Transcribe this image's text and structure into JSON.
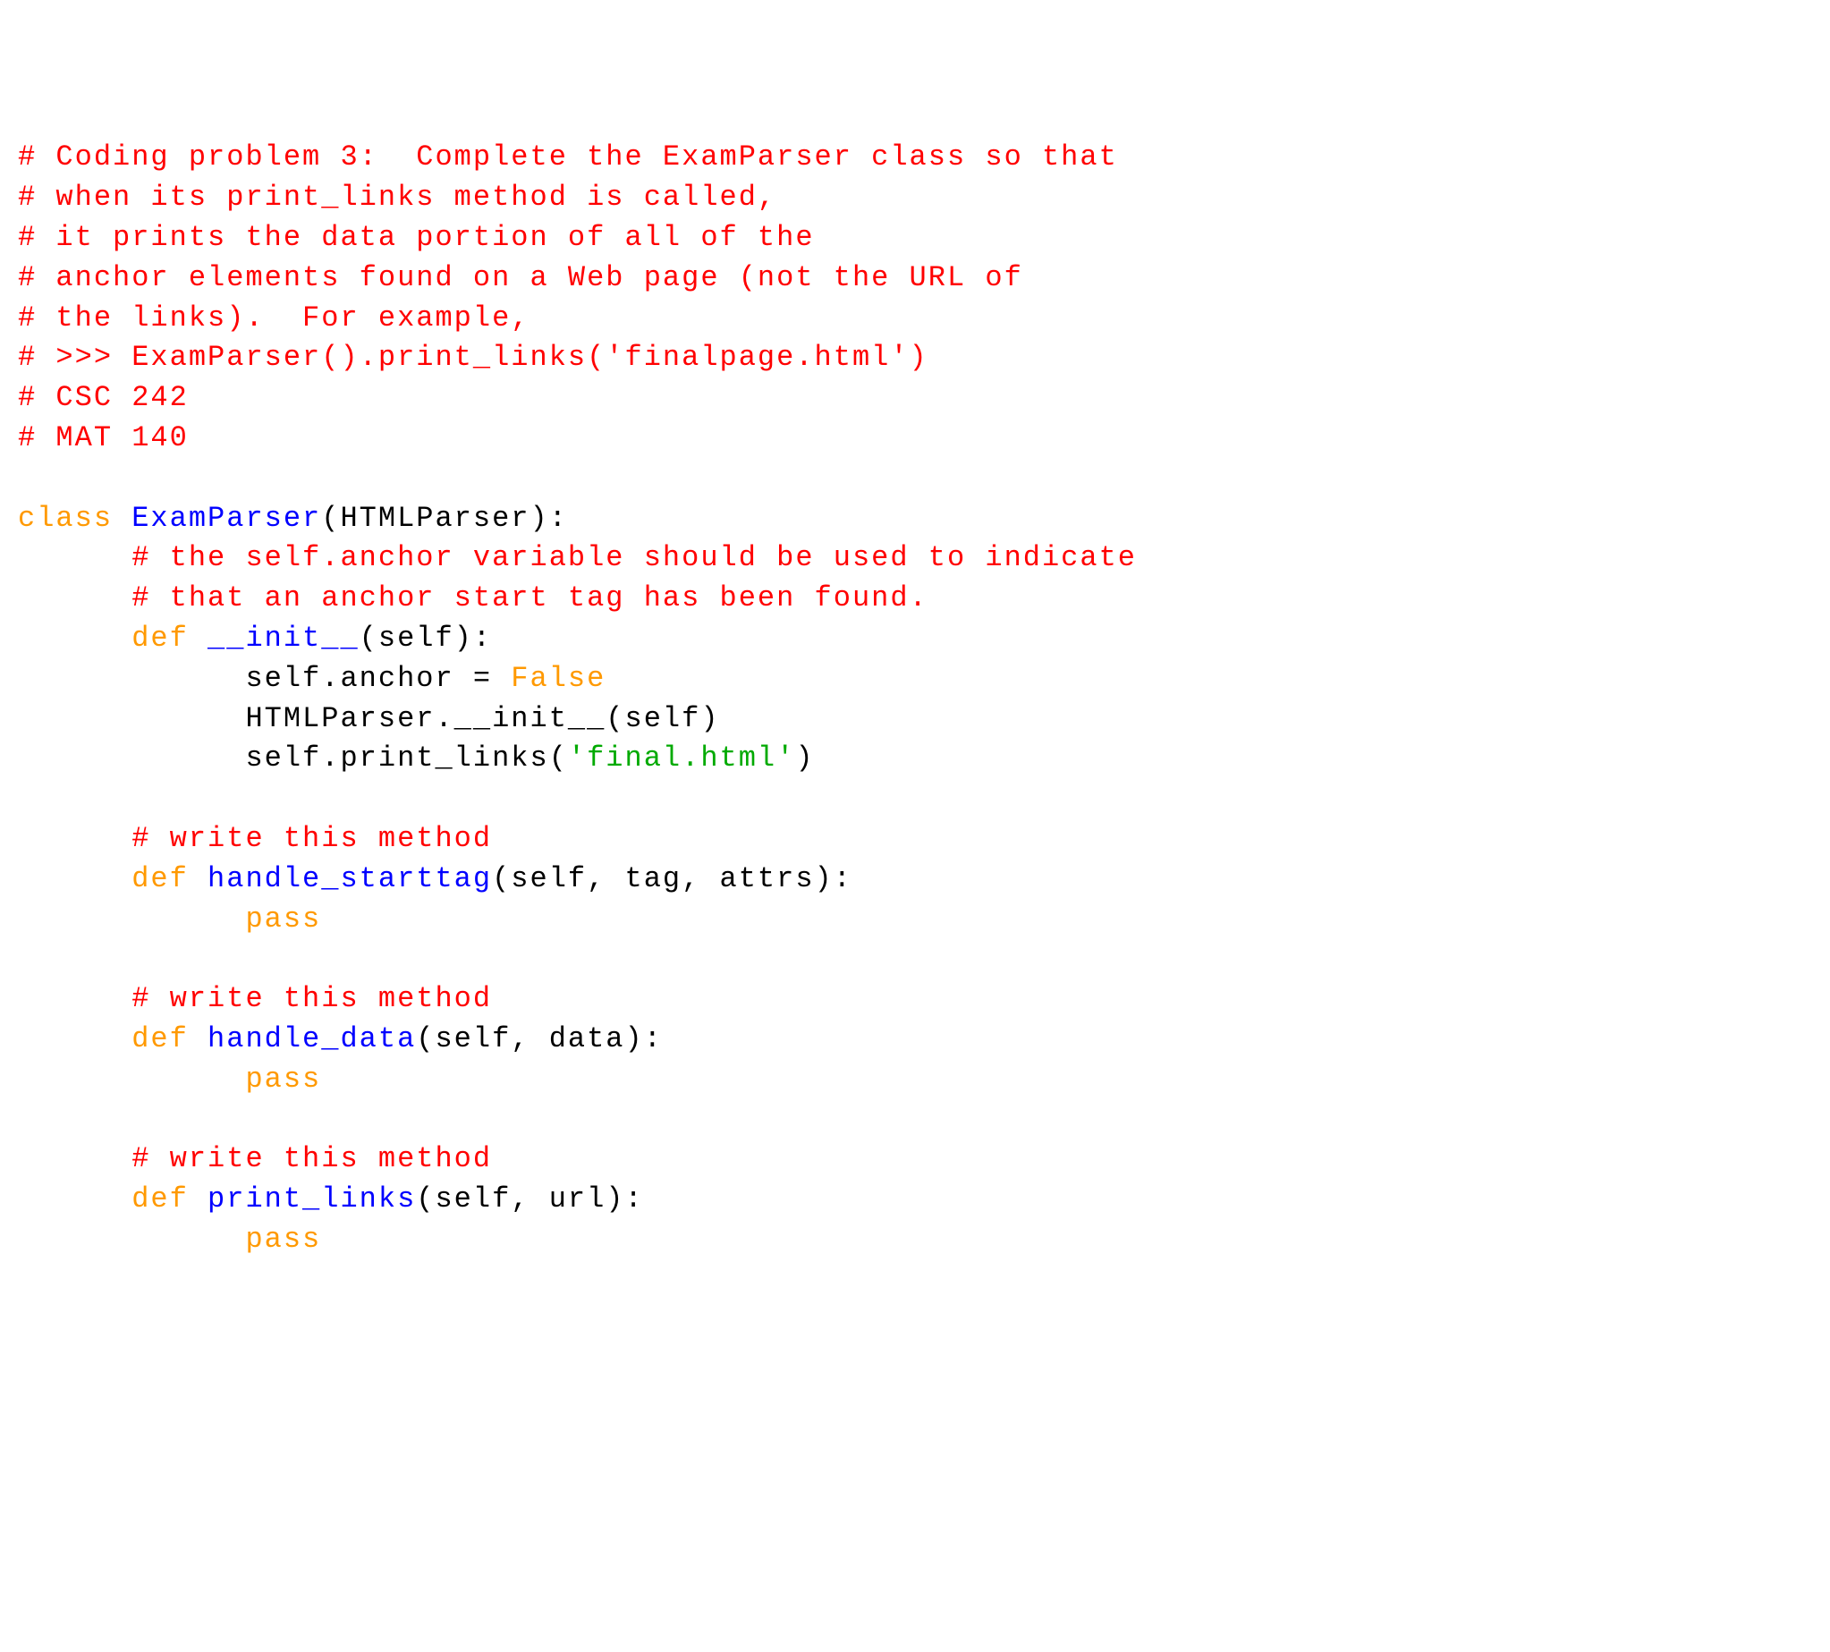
{
  "tokens": [
    {
      "cls": "comment",
      "text": "# Coding problem 3:  Complete the ExamParser class so that"
    },
    {
      "cls": "nl"
    },
    {
      "cls": "comment",
      "text": "# when its print_links method is called,"
    },
    {
      "cls": "nl"
    },
    {
      "cls": "comment",
      "text": "# it prints the data portion of all of the"
    },
    {
      "cls": "nl"
    },
    {
      "cls": "comment",
      "text": "# anchor elements found on a Web page (not the URL of"
    },
    {
      "cls": "nl"
    },
    {
      "cls": "comment",
      "text": "# the links).  For example,"
    },
    {
      "cls": "nl"
    },
    {
      "cls": "comment",
      "text": "# >>> ExamParser().print_links('finalpage.html')"
    },
    {
      "cls": "nl"
    },
    {
      "cls": "comment",
      "text": "# CSC 242"
    },
    {
      "cls": "nl"
    },
    {
      "cls": "comment",
      "text": "# MAT 140"
    },
    {
      "cls": "nl"
    },
    {
      "cls": "nl"
    },
    {
      "cls": "keyword",
      "text": "class "
    },
    {
      "cls": "defname",
      "text": "ExamParser"
    },
    {
      "cls": "default",
      "text": "(HTMLParser):"
    },
    {
      "cls": "nl"
    },
    {
      "cls": "default",
      "text": "      "
    },
    {
      "cls": "comment",
      "text": "# the self.anchor variable should be used to indicate"
    },
    {
      "cls": "nl"
    },
    {
      "cls": "default",
      "text": "      "
    },
    {
      "cls": "comment",
      "text": "# that an anchor start tag has been found."
    },
    {
      "cls": "nl"
    },
    {
      "cls": "default",
      "text": "      "
    },
    {
      "cls": "keyword",
      "text": "def "
    },
    {
      "cls": "defname",
      "text": "__init__"
    },
    {
      "cls": "default",
      "text": "(self):"
    },
    {
      "cls": "nl"
    },
    {
      "cls": "default",
      "text": "            self.anchor = "
    },
    {
      "cls": "keyword",
      "text": "False"
    },
    {
      "cls": "nl"
    },
    {
      "cls": "default",
      "text": "            HTMLParser.__init__(self)"
    },
    {
      "cls": "nl"
    },
    {
      "cls": "default",
      "text": "            self.print_links("
    },
    {
      "cls": "string",
      "text": "'final.html'"
    },
    {
      "cls": "default",
      "text": ")"
    },
    {
      "cls": "nl"
    },
    {
      "cls": "nl"
    },
    {
      "cls": "default",
      "text": "      "
    },
    {
      "cls": "comment",
      "text": "# write this method"
    },
    {
      "cls": "nl"
    },
    {
      "cls": "default",
      "text": "      "
    },
    {
      "cls": "keyword",
      "text": "def "
    },
    {
      "cls": "defname",
      "text": "handle_starttag"
    },
    {
      "cls": "default",
      "text": "(self, tag, attrs):"
    },
    {
      "cls": "nl"
    },
    {
      "cls": "default",
      "text": "            "
    },
    {
      "cls": "keyword",
      "text": "pass"
    },
    {
      "cls": "nl"
    },
    {
      "cls": "nl"
    },
    {
      "cls": "default",
      "text": "      "
    },
    {
      "cls": "comment",
      "text": "# write this method"
    },
    {
      "cls": "nl"
    },
    {
      "cls": "default",
      "text": "      "
    },
    {
      "cls": "keyword",
      "text": "def "
    },
    {
      "cls": "defname",
      "text": "handle_data"
    },
    {
      "cls": "default",
      "text": "(self, data):"
    },
    {
      "cls": "nl"
    },
    {
      "cls": "default",
      "text": "            "
    },
    {
      "cls": "keyword",
      "text": "pass"
    },
    {
      "cls": "nl"
    },
    {
      "cls": "nl"
    },
    {
      "cls": "default",
      "text": "      "
    },
    {
      "cls": "comment",
      "text": "# write this method"
    },
    {
      "cls": "nl"
    },
    {
      "cls": "default",
      "text": "      "
    },
    {
      "cls": "keyword",
      "text": "def "
    },
    {
      "cls": "defname",
      "text": "print_links"
    },
    {
      "cls": "default",
      "text": "(self, url):"
    },
    {
      "cls": "nl"
    },
    {
      "cls": "default",
      "text": "            "
    },
    {
      "cls": "keyword",
      "text": "pass"
    },
    {
      "cls": "nl"
    }
  ]
}
